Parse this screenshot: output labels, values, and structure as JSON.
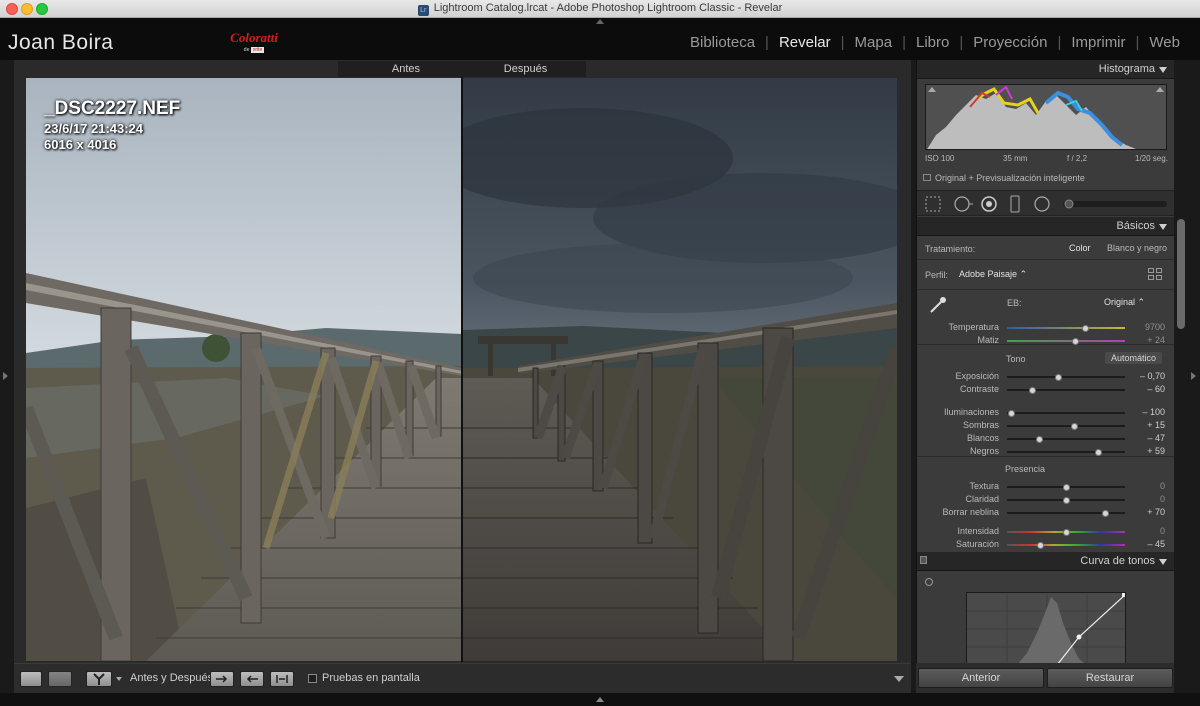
{
  "window": {
    "title": "Lightroom Catalog.lrcat - Adobe Photoshop Lightroom Classic - Revelar",
    "app_icon": "Lr"
  },
  "identity": {
    "plate": "Joan Boira",
    "logo_word": "Coloratti",
    "logo_sub_prefix": "de",
    "logo_sub_badge": "xrite"
  },
  "modules": [
    "Biblioteca",
    "Revelar",
    "Mapa",
    "Libro",
    "Proyección",
    "Imprimir",
    "Web"
  ],
  "active_module": "Revelar",
  "compare": {
    "before_label": "Antes",
    "after_label": "Después"
  },
  "photo": {
    "filename": "_DSC2227.NEF",
    "datetime": "23/6/17 21:43:24",
    "dimensions": "6016 x 4016"
  },
  "toolbar": {
    "before_after_label": "Antes y Después:",
    "soft_proof_label": "Pruebas en pantalla"
  },
  "histogram": {
    "title": "Histograma",
    "iso": "ISO 100",
    "focal": "35 mm",
    "aperture": "f / 2,2",
    "shutter": "1/20 seg.",
    "preview": "Original + Previsualización inteligente"
  },
  "basic": {
    "title": "Básicos",
    "treatment_label": "Tratamiento:",
    "treatment_color": "Color",
    "treatment_bw": "Blanco y negro",
    "profile_label": "Perfil:",
    "profile_value": "Adobe Paisaje",
    "wb_label": "EB:",
    "wb_value": "Original",
    "tone_label": "Tono",
    "auto_label": "Automático",
    "presence_label": "Presencia"
  },
  "sliders": [
    {
      "label": "Temperatura",
      "value": "9700",
      "pos": 0.66,
      "dim": true
    },
    {
      "label": "Matiz",
      "value": "+ 24",
      "pos": 0.58,
      "dim": true
    },
    {
      "label": "Exposición",
      "value": "– 0,70",
      "pos": 0.43,
      "dim": false
    },
    {
      "label": "Contraste",
      "value": "– 60",
      "pos": 0.21,
      "dim": false
    },
    {
      "label": "Iluminaciones",
      "value": "– 100",
      "pos": 0.03,
      "dim": false
    },
    {
      "label": "Sombras",
      "value": "+ 15",
      "pos": 0.57,
      "dim": false
    },
    {
      "label": "Blancos",
      "value": "– 47",
      "pos": 0.27,
      "dim": false
    },
    {
      "label": "Negros",
      "value": "+ 59",
      "pos": 0.77,
      "dim": false
    },
    {
      "label": "Textura",
      "value": "0",
      "pos": 0.5,
      "dim": true
    },
    {
      "label": "Claridad",
      "value": "0",
      "pos": 0.5,
      "dim": true
    },
    {
      "label": "Borrar neblina",
      "value": "+ 70",
      "pos": 0.83,
      "dim": false
    },
    {
      "label": "Intensidad",
      "value": "0",
      "pos": 0.5,
      "dim": true
    },
    {
      "label": "Saturación",
      "value": "– 45",
      "pos": 0.28,
      "dim": false
    }
  ],
  "tone_curve": {
    "title": "Curva de tonos"
  },
  "footer": {
    "previous": "Anterior",
    "reset": "Restaurar"
  },
  "colors": {
    "panel_bg": "#3b3b3b",
    "accent_text": "#e8e8e8",
    "logo_red": "#e0181b"
  }
}
